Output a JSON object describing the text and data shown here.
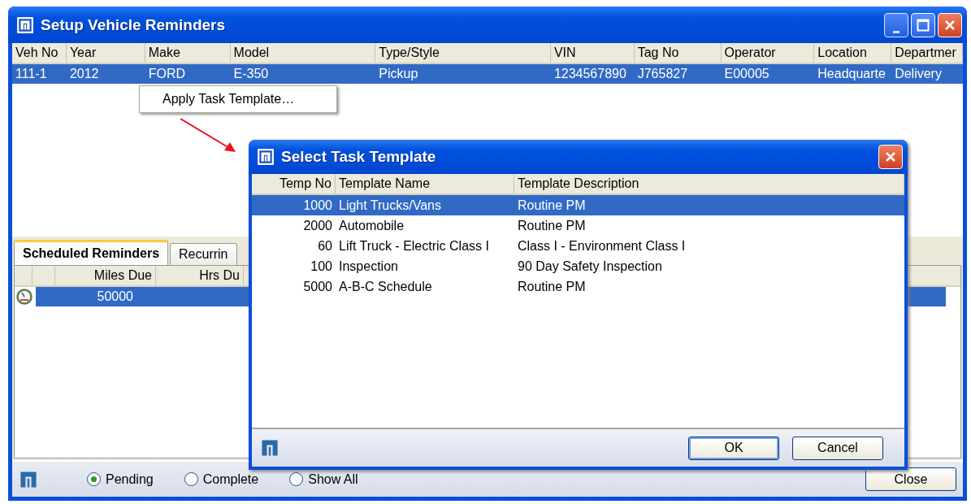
{
  "window": {
    "title": "Setup Vehicle Reminders"
  },
  "vehicles": {
    "columns": [
      "Veh No",
      "Year",
      "Make",
      "Model",
      "Type/Style",
      "VIN",
      "Tag No",
      "Operator",
      "Location",
      "Departmer"
    ],
    "rows": [
      {
        "selected": true,
        "cells": [
          "111-1",
          "2012",
          "FORD",
          "E-350",
          "Pickup",
          "1234567890",
          "J765827",
          "E00005",
          "Headquarte",
          "Delivery"
        ]
      }
    ]
  },
  "context_menu": {
    "items": [
      {
        "label": "Apply Task Template…"
      }
    ]
  },
  "tabs": [
    {
      "label": "Scheduled Reminders",
      "selected": true
    },
    {
      "label": "Recurrin",
      "selected": false
    }
  ],
  "reminders": {
    "columns": [
      "Miles Due",
      "Hrs Du"
    ],
    "rows": [
      {
        "selected": true,
        "miles_due": "50000"
      }
    ]
  },
  "filters": [
    {
      "label": "Pending",
      "selected": true
    },
    {
      "label": "Complete",
      "selected": false
    },
    {
      "label": "Show All",
      "selected": false
    }
  ],
  "close_button": "Close",
  "dialog": {
    "title": "Select Task Template",
    "columns": [
      "Temp No",
      "Template Name",
      "Template Description"
    ],
    "rows": [
      {
        "selected": true,
        "temp_no": "1000",
        "name": "Light Trucks/Vans",
        "description": "Routine PM"
      },
      {
        "selected": false,
        "temp_no": "2000",
        "name": "Automobile",
        "description": "Routine PM"
      },
      {
        "selected": false,
        "temp_no": "60",
        "name": "Lift Truck - Electric Class I",
        "description": "Class I - Environment Class I"
      },
      {
        "selected": false,
        "temp_no": "100",
        "name": "Inspection",
        "description": "90 Day Safety Inspection"
      },
      {
        "selected": false,
        "temp_no": "5000",
        "name": "A-B-C Schedule",
        "description": "Routine PM"
      }
    ],
    "buttons": [
      {
        "label": "OK",
        "focused": true
      },
      {
        "label": "Cancel",
        "focused": false
      }
    ]
  }
}
